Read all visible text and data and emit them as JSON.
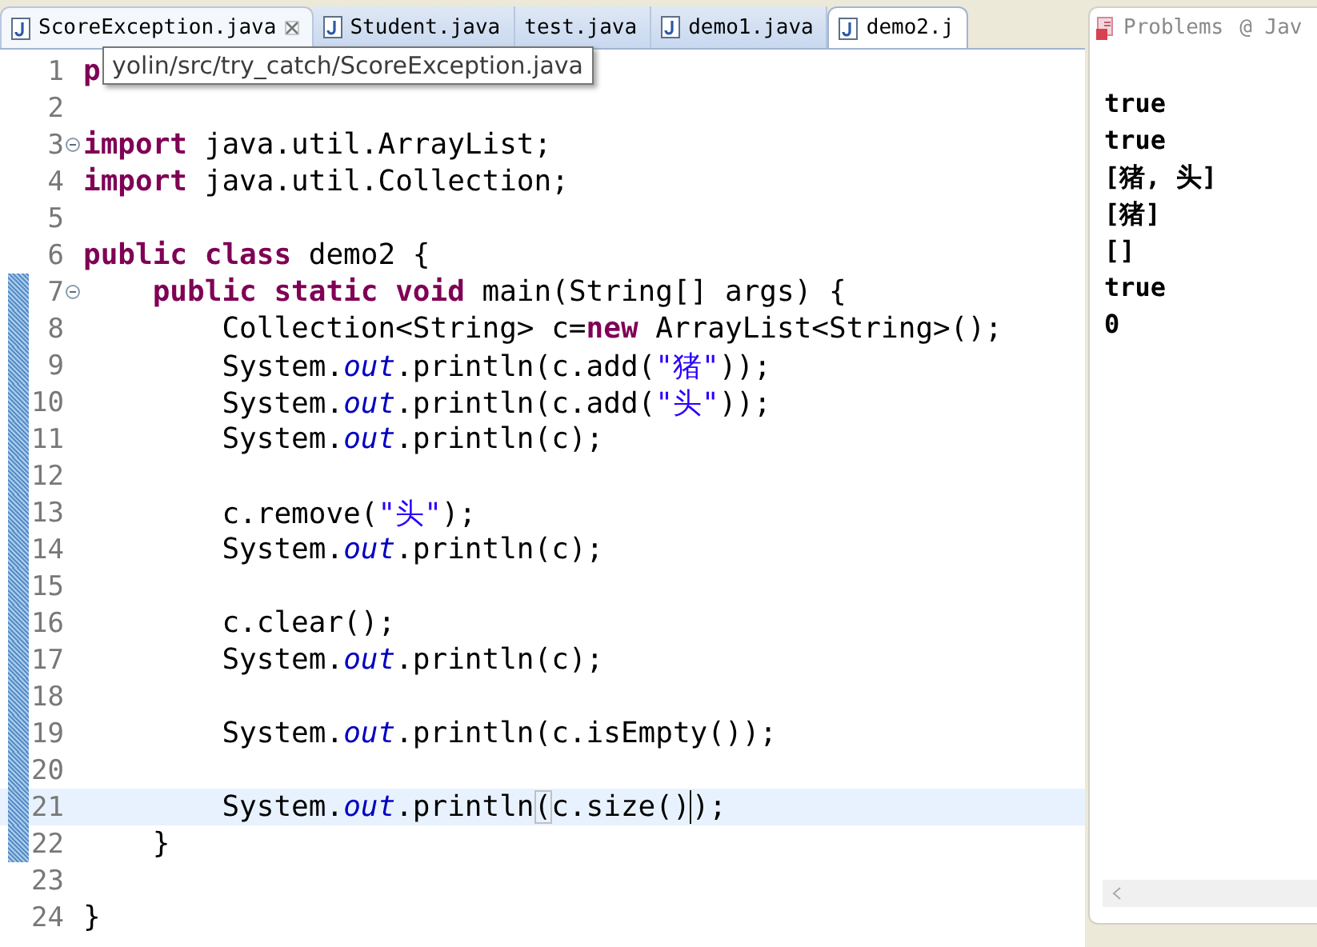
{
  "editor": {
    "tabs": [
      {
        "label": "ScoreException.java",
        "icon": true,
        "selected": false,
        "closable": true
      },
      {
        "label": "Student.java",
        "icon": true,
        "selected": false,
        "closable": false
      },
      {
        "label": "test.java",
        "icon": false,
        "selected": false,
        "closable": false
      },
      {
        "label": "demo1.java",
        "icon": true,
        "selected": false,
        "closable": false
      },
      {
        "label": "demo2.j",
        "icon": true,
        "selected": true,
        "closable": false
      }
    ],
    "tooltip": "yolin/src/try_catch/ScoreException.java",
    "lines": [
      {
        "number": "1",
        "changed": false,
        "current": false,
        "fold": false,
        "tokens": [
          {
            "kind": "keyword",
            "text": "p"
          }
        ]
      },
      {
        "number": "2",
        "changed": false,
        "current": false,
        "fold": false
      },
      {
        "number": "3",
        "changed": false,
        "current": false,
        "fold": true,
        "tokens": [
          {
            "kind": "keyword",
            "text": "import"
          },
          {
            "kind": "plain",
            "text": " java.util.ArrayList;"
          }
        ]
      },
      {
        "number": "4",
        "changed": false,
        "current": false,
        "fold": false,
        "tokens": [
          {
            "kind": "keyword",
            "text": "import"
          },
          {
            "kind": "plain",
            "text": " java.util.Collection;"
          }
        ]
      },
      {
        "number": "5",
        "changed": false,
        "current": false,
        "fold": false
      },
      {
        "number": "6",
        "changed": false,
        "current": false,
        "fold": false,
        "tokens": [
          {
            "kind": "keyword",
            "text": "public class"
          },
          {
            "kind": "plain",
            "text": " demo2 {"
          }
        ]
      },
      {
        "number": "7",
        "changed": true,
        "current": false,
        "fold": true,
        "tokens": [
          {
            "kind": "keyword",
            "text": "    public static void"
          },
          {
            "kind": "plain",
            "text": " main(String[] args) {"
          }
        ]
      },
      {
        "number": "8",
        "changed": true,
        "current": false,
        "fold": false,
        "tokens": [
          {
            "kind": "plain",
            "text": "        Collection<String> c="
          },
          {
            "kind": "keyword",
            "text": "new"
          },
          {
            "kind": "plain",
            "text": " ArrayList<String>();"
          }
        ]
      },
      {
        "number": "9",
        "changed": true,
        "current": false,
        "fold": false,
        "tokens": [
          {
            "kind": "plain",
            "text": "        System."
          },
          {
            "kind": "field",
            "text": "out"
          },
          {
            "kind": "plain",
            "text": ".println(c.add("
          },
          {
            "kind": "string",
            "text": "\"猪\""
          },
          {
            "kind": "plain",
            "text": "));"
          }
        ]
      },
      {
        "number": "10",
        "changed": true,
        "current": false,
        "fold": false,
        "tokens": [
          {
            "kind": "plain",
            "text": "        System."
          },
          {
            "kind": "field",
            "text": "out"
          },
          {
            "kind": "plain",
            "text": ".println(c.add("
          },
          {
            "kind": "string",
            "text": "\"头\""
          },
          {
            "kind": "plain",
            "text": "));"
          }
        ]
      },
      {
        "number": "11",
        "changed": true,
        "current": false,
        "fold": false,
        "tokens": [
          {
            "kind": "plain",
            "text": "        System."
          },
          {
            "kind": "field",
            "text": "out"
          },
          {
            "kind": "plain",
            "text": ".println(c);"
          }
        ]
      },
      {
        "number": "12",
        "changed": true,
        "current": false,
        "fold": false
      },
      {
        "number": "13",
        "changed": true,
        "current": false,
        "fold": false,
        "tokens": [
          {
            "kind": "plain",
            "text": "        c.remove("
          },
          {
            "kind": "string",
            "text": "\"头\""
          },
          {
            "kind": "plain",
            "text": ");"
          }
        ]
      },
      {
        "number": "14",
        "changed": true,
        "current": false,
        "fold": false,
        "tokens": [
          {
            "kind": "plain",
            "text": "        System."
          },
          {
            "kind": "field",
            "text": "out"
          },
          {
            "kind": "plain",
            "text": ".println(c);"
          }
        ]
      },
      {
        "number": "15",
        "changed": true,
        "current": false,
        "fold": false
      },
      {
        "number": "16",
        "changed": true,
        "current": false,
        "fold": false,
        "tokens": [
          {
            "kind": "plain",
            "text": "        c.clear();"
          }
        ]
      },
      {
        "number": "17",
        "changed": true,
        "current": false,
        "fold": false,
        "tokens": [
          {
            "kind": "plain",
            "text": "        System."
          },
          {
            "kind": "field",
            "text": "out"
          },
          {
            "kind": "plain",
            "text": ".println(c);"
          }
        ]
      },
      {
        "number": "18",
        "changed": true,
        "current": false,
        "fold": false
      },
      {
        "number": "19",
        "changed": true,
        "current": false,
        "fold": false,
        "tokens": [
          {
            "kind": "plain",
            "text": "        System."
          },
          {
            "kind": "field",
            "text": "out"
          },
          {
            "kind": "plain",
            "text": ".println(c.isEmpty());"
          }
        ]
      },
      {
        "number": "20",
        "changed": true,
        "current": false,
        "fold": false
      },
      {
        "number": "21",
        "changed": true,
        "current": true,
        "fold": false,
        "tokens": [
          {
            "kind": "plain",
            "text": "        System."
          },
          {
            "kind": "field",
            "text": "out"
          },
          {
            "kind": "plain",
            "text": ".println"
          },
          {
            "kind": "match",
            "text": "("
          },
          {
            "kind": "plain",
            "text": "c.size()"
          },
          {
            "kind": "caret",
            "text": ");"
          }
        ]
      },
      {
        "number": "22",
        "changed": true,
        "current": false,
        "fold": false,
        "tokens": [
          {
            "kind": "plain",
            "text": "    }"
          }
        ]
      },
      {
        "number": "23",
        "changed": false,
        "current": false,
        "fold": false
      },
      {
        "number": "24",
        "changed": false,
        "current": false,
        "fold": false,
        "tokens": [
          {
            "kind": "plain",
            "text": "}"
          }
        ]
      }
    ]
  },
  "console": {
    "tabs": [
      {
        "label": "Problems",
        "icon": true
      },
      {
        "label": "@ Jav",
        "icon": false
      }
    ],
    "output": [
      "true",
      "true",
      "[猪, 头]",
      "[猪]",
      "[]",
      "true",
      "0"
    ]
  }
}
